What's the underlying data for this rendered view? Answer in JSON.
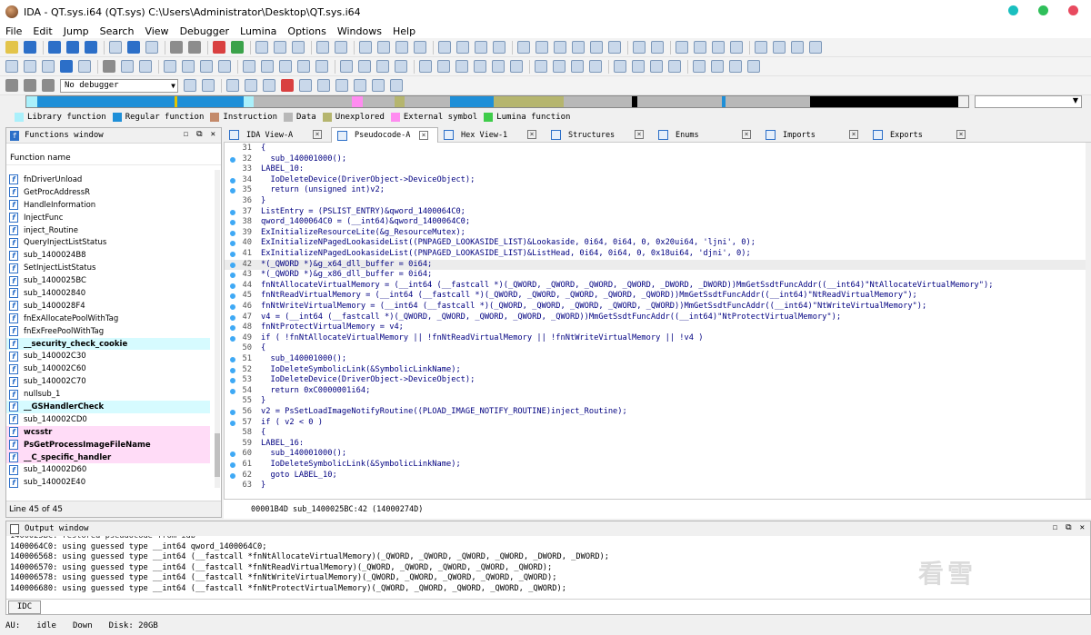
{
  "window": {
    "title": "IDA - QT.sys.i64 (QT.sys) C:\\Users\\Administrator\\Desktop\\QT.sys.i64",
    "traffic_lights": [
      "#1abfbf",
      "#2fbf5a",
      "#e84a5f"
    ]
  },
  "menu": [
    "File",
    "Edit",
    "Jump",
    "Search",
    "View",
    "Debugger",
    "Lumina",
    "Options",
    "Windows",
    "Help"
  ],
  "debugger_select": "No debugger",
  "legend": [
    {
      "label": "Library function",
      "color": "#aaf0fb"
    },
    {
      "label": "Regular function",
      "color": "#1e8fd8"
    },
    {
      "label": "Instruction",
      "color": "#c48a6a"
    },
    {
      "label": "Data",
      "color": "#b8b8b8"
    },
    {
      "label": "Unexplored",
      "color": "#b5b56e"
    },
    {
      "label": "External symbol",
      "color": "#ff8cf0"
    },
    {
      "label": "Lumina function",
      "color": "#3fcc4a"
    }
  ],
  "functions_window": {
    "title": "Functions window",
    "column": "Function name",
    "status": "Line 45 of 45",
    "items": [
      {
        "name": "fnDriverUnload",
        "kind": "regular"
      },
      {
        "name": "GetProcAddressR",
        "kind": "regular"
      },
      {
        "name": "HandleInformation",
        "kind": "regular"
      },
      {
        "name": "InjectFunc",
        "kind": "regular"
      },
      {
        "name": "inject_Routine",
        "kind": "regular"
      },
      {
        "name": "QueryInjectListStatus",
        "kind": "regular"
      },
      {
        "name": "sub_1400024B8",
        "kind": "regular"
      },
      {
        "name": "SetInjectListStatus",
        "kind": "regular"
      },
      {
        "name": "sub_1400025BC",
        "kind": "regular"
      },
      {
        "name": "sub_140002840",
        "kind": "regular"
      },
      {
        "name": "sub_1400028F4",
        "kind": "regular"
      },
      {
        "name": "fnExAllocatePoolWithTag",
        "kind": "regular"
      },
      {
        "name": "fnExFreePoolWithTag",
        "kind": "regular"
      },
      {
        "name": "__security_check_cookie",
        "kind": "library"
      },
      {
        "name": "sub_140002C30",
        "kind": "regular"
      },
      {
        "name": "sub_140002C60",
        "kind": "regular"
      },
      {
        "name": "sub_140002C70",
        "kind": "regular"
      },
      {
        "name": "nullsub_1",
        "kind": "regular"
      },
      {
        "name": "__GSHandlerCheck",
        "kind": "library"
      },
      {
        "name": "sub_140002CD0",
        "kind": "regular"
      },
      {
        "name": "wcsstr",
        "kind": "external"
      },
      {
        "name": "PsGetProcessImageFileName",
        "kind": "external"
      },
      {
        "name": "__C_specific_handler",
        "kind": "external"
      },
      {
        "name": "sub_140002D60",
        "kind": "regular"
      },
      {
        "name": "sub_140002E40",
        "kind": "regular"
      }
    ]
  },
  "tabs": [
    {
      "label": "IDA View-A",
      "active": false
    },
    {
      "label": "Pseudocode-A",
      "active": true
    },
    {
      "label": "Hex View-1",
      "active": false
    },
    {
      "label": "Structures",
      "active": false
    },
    {
      "label": "Enums",
      "active": false
    },
    {
      "label": "Imports",
      "active": false
    },
    {
      "label": "Exports",
      "active": false
    }
  ],
  "code": {
    "highlight_line": 42,
    "rows": [
      {
        "n": 31,
        "t": "{",
        "bp": false
      },
      {
        "n": 32,
        "t": "  sub_140001000();",
        "bp": true
      },
      {
        "n": 33,
        "t": "LABEL_10:",
        "bp": false
      },
      {
        "n": 34,
        "t": "  IoDeleteDevice(DriverObject->DeviceObject);",
        "bp": true
      },
      {
        "n": 35,
        "t": "  return (unsigned int)v2;",
        "bp": true
      },
      {
        "n": 36,
        "t": "}",
        "bp": false
      },
      {
        "n": 37,
        "t": "ListEntry = (PSLIST_ENTRY)&qword_1400064C0;",
        "bp": true
      },
      {
        "n": 38,
        "t": "qword_1400064C0 = (__int64)&qword_1400064C0;",
        "bp": true
      },
      {
        "n": 39,
        "t": "ExInitializeResourceLite(&g_ResourceMutex);",
        "bp": true
      },
      {
        "n": 40,
        "t": "ExInitializeNPagedLookasideList((PNPAGED_LOOKASIDE_LIST)&Lookaside, 0i64, 0i64, 0, 0x20ui64, 'ljni', 0);",
        "bp": true
      },
      {
        "n": 41,
        "t": "ExInitializeNPagedLookasideList((PNPAGED_LOOKASIDE_LIST)&ListHead, 0i64, 0i64, 0, 0x18ui64, 'djni', 0);",
        "bp": true
      },
      {
        "n": 42,
        "t": "*(_QWORD *)&g_x64_dll_buffer = 0i64;",
        "bp": true
      },
      {
        "n": 43,
        "t": "*(_QWORD *)&g_x86_dll_buffer = 0i64;",
        "bp": true
      },
      {
        "n": 44,
        "t": "fnNtAllocateVirtualMemory = (__int64 (__fastcall *)(_QWORD, _QWORD, _QWORD, _QWORD, _DWORD, _DWORD))MmGetSsdtFuncAddr((__int64)\"NtAllocateVirtualMemory\");",
        "bp": true
      },
      {
        "n": 45,
        "t": "fnNtReadVirtualMemory = (__int64 (__fastcall *)(_QWORD, _QWORD, _QWORD, _QWORD, _QWORD))MmGetSsdtFuncAddr((__int64)\"NtReadVirtualMemory\");",
        "bp": true
      },
      {
        "n": 46,
        "t": "fnNtWriteVirtualMemory = (__int64 (__fastcall *)(_QWORD, _QWORD, _QWORD, _QWORD, _QWORD))MmGetSsdtFuncAddr((__int64)\"NtWriteVirtualMemory\");",
        "bp": true
      },
      {
        "n": 47,
        "t": "v4 = (__int64 (__fastcall *)(_QWORD, _QWORD, _QWORD, _QWORD, _QWORD))MmGetSsdtFuncAddr((__int64)\"NtProtectVirtualMemory\");",
        "bp": true
      },
      {
        "n": 48,
        "t": "fnNtProtectVirtualMemory = v4;",
        "bp": true
      },
      {
        "n": 49,
        "t": "if ( !fnNtAllocateVirtualMemory || !fnNtReadVirtualMemory || !fnNtWriteVirtualMemory || !v4 )",
        "bp": true
      },
      {
        "n": 50,
        "t": "{",
        "bp": false
      },
      {
        "n": 51,
        "t": "  sub_140001000();",
        "bp": true
      },
      {
        "n": 52,
        "t": "  IoDeleteSymbolicLink(&SymbolicLinkName);",
        "bp": true
      },
      {
        "n": 53,
        "t": "  IoDeleteDevice(DriverObject->DeviceObject);",
        "bp": true
      },
      {
        "n": 54,
        "t": "  return 0xC0000001i64;",
        "bp": true
      },
      {
        "n": 55,
        "t": "}",
        "bp": false
      },
      {
        "n": 56,
        "t": "v2 = PsSetLoadImageNotifyRoutine((PLOAD_IMAGE_NOTIFY_ROUTINE)inject_Routine);",
        "bp": true
      },
      {
        "n": 57,
        "t": "if ( v2 < 0 )",
        "bp": true
      },
      {
        "n": 58,
        "t": "{",
        "bp": false
      },
      {
        "n": 59,
        "t": "LABEL_16:",
        "bp": false
      },
      {
        "n": 60,
        "t": "  sub_140001000();",
        "bp": true
      },
      {
        "n": 61,
        "t": "  IoDeleteSymbolicLink(&SymbolicLinkName);",
        "bp": true
      },
      {
        "n": 62,
        "t": "  goto LABEL_10;",
        "bp": true
      },
      {
        "n": 63,
        "t": "}",
        "bp": false
      }
    ],
    "address_bar": "00001B4D sub_1400025BC:42 (14000274D)"
  },
  "output_window": {
    "title": "Output window",
    "lines": [
      "1400025BC: restored pseudocode from idb",
      "1400064C0: using guessed type __int64 qword_1400064C0;",
      "140006568: using guessed type __int64 (__fastcall *fnNtAllocateVirtualMemory)(_QWORD, _QWORD, _QWORD, _QWORD, _DWORD, _DWORD);",
      "140006570: using guessed type __int64 (__fastcall *fnNtReadVirtualMemory)(_QWORD, _QWORD, _QWORD, _QWORD, _QWORD);",
      "140006578: using guessed type __int64 (__fastcall *fnNtWriteVirtualMemory)(_QWORD, _QWORD, _QWORD, _QWORD, _QWORD);",
      "140006680: using guessed type __int64 (__fastcall *fnNtProtectVirtualMemory)(_QWORD, _QWORD, _QWORD, _QWORD, _QWORD);"
    ],
    "idc_button": "IDC"
  },
  "watermark": "看雪",
  "statusbar": {
    "au": "AU:",
    "state": "idle",
    "direction": "Down",
    "disk": "Disk: 20GB"
  }
}
